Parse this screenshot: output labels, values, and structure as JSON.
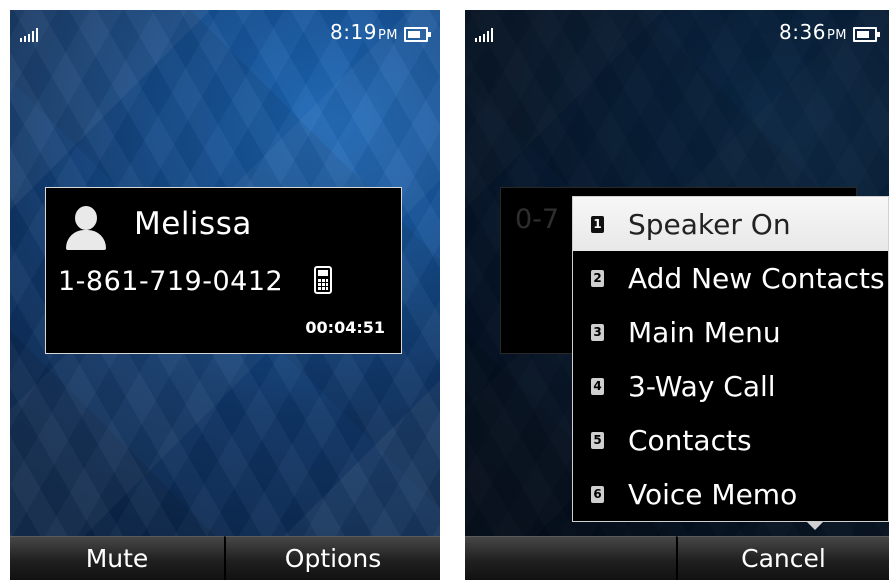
{
  "left_screen": {
    "status": {
      "time": "8:19",
      "ampm": "PM"
    },
    "call": {
      "name": "Melissa",
      "number": "1-861-719-0412",
      "duration": "00:04:51"
    },
    "softkeys": {
      "left": "Mute",
      "right": "Options"
    }
  },
  "right_screen": {
    "status": {
      "time": "8:36",
      "ampm": "PM"
    },
    "background_number": "0-7",
    "menu": [
      {
        "num": "1",
        "label": "Speaker On",
        "highlighted": true
      },
      {
        "num": "2",
        "label": "Add New Contacts"
      },
      {
        "num": "3",
        "label": "Main Menu"
      },
      {
        "num": "4",
        "label": "3-Way Call"
      },
      {
        "num": "5",
        "label": "Contacts"
      },
      {
        "num": "6",
        "label": "Voice Memo"
      }
    ],
    "softkeys": {
      "left": "",
      "right": "Cancel"
    }
  },
  "icons": [
    "signal-icon",
    "battery-icon",
    "person-icon",
    "mobile-phone-icon"
  ]
}
